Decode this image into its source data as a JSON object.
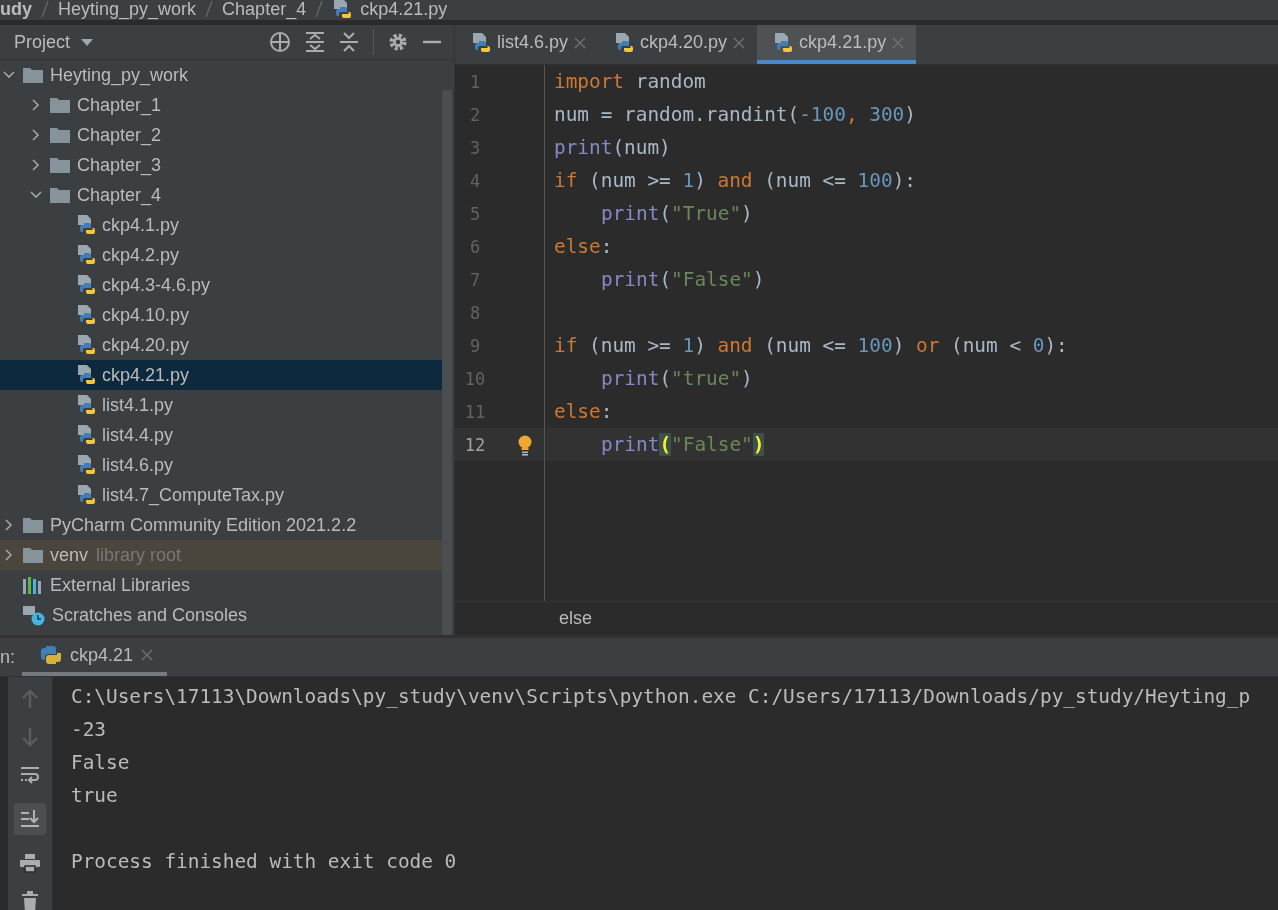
{
  "breadcrumb": [
    {
      "label": "udy",
      "kind": "project"
    },
    {
      "label": "Heyting_py_work",
      "kind": "folder"
    },
    {
      "label": "Chapter_4",
      "kind": "folder"
    },
    {
      "label": "ckp4.21.py",
      "kind": "python"
    }
  ],
  "project_panel": {
    "title": "Project",
    "tree": [
      {
        "label": "Heyting_py_work",
        "kind": "folder",
        "expanded": true,
        "selected": false,
        "children": [
          {
            "label": "Chapter_1",
            "kind": "folder",
            "expanded": false,
            "selected": false
          },
          {
            "label": "Chapter_2",
            "kind": "folder",
            "expanded": false,
            "selected": false
          },
          {
            "label": "Chapter_3",
            "kind": "folder",
            "expanded": false,
            "selected": false
          },
          {
            "label": "Chapter_4",
            "kind": "folder",
            "expanded": true,
            "selected": false,
            "children": [
              {
                "label": "ckp4.1.py",
                "kind": "python",
                "selected": false
              },
              {
                "label": "ckp4.2.py",
                "kind": "python",
                "selected": false
              },
              {
                "label": "ckp4.3-4.6.py",
                "kind": "python",
                "selected": false
              },
              {
                "label": "ckp4.10.py",
                "kind": "python",
                "selected": false
              },
              {
                "label": "ckp4.20.py",
                "kind": "python",
                "selected": false
              },
              {
                "label": "ckp4.21.py",
                "kind": "python",
                "selected": true
              },
              {
                "label": "list4.1.py",
                "kind": "python",
                "selected": false
              },
              {
                "label": "list4.4.py",
                "kind": "python",
                "selected": false
              },
              {
                "label": "list4.6.py",
                "kind": "python",
                "selected": false
              },
              {
                "label": "list4.7_ComputeTax.py",
                "kind": "python",
                "selected": false
              }
            ]
          }
        ]
      },
      {
        "label": "PyCharm Community Edition 2021.2.2",
        "kind": "folder",
        "expanded": false,
        "selected": false
      },
      {
        "label": "venv",
        "hint": "library root",
        "kind": "library-folder",
        "expanded": false,
        "selected": false
      },
      {
        "label": "External Libraries",
        "kind": "libraries",
        "selected": false
      },
      {
        "label": "Scratches and Consoles",
        "kind": "scratches",
        "selected": false
      }
    ]
  },
  "editor_tabs": [
    {
      "label": "list4.6.py",
      "selected": false
    },
    {
      "label": "ckp4.20.py",
      "selected": false
    },
    {
      "label": "ckp4.21.py",
      "selected": true
    }
  ],
  "code_lines": [
    {
      "number": "1",
      "current": false,
      "indent": false,
      "tokens": [
        {
          "t": "import",
          "color": "#cc7832"
        },
        {
          "t": " random",
          "color": "#a9b7c6"
        }
      ]
    },
    {
      "number": "2",
      "current": false,
      "indent": false,
      "tokens": [
        {
          "t": "num = random.randint(",
          "color": "#a9b7c6"
        },
        {
          "t": "-100",
          "color": "#6897bb"
        },
        {
          "t": ", ",
          "color": "#cc7832"
        },
        {
          "t": "300",
          "color": "#6897bb"
        },
        {
          "t": ")",
          "color": "#a9b7c6"
        }
      ]
    },
    {
      "number": "3",
      "current": false,
      "indent": false,
      "tokens": [
        {
          "t": "print",
          "color": "#8888c6"
        },
        {
          "t": "(num)",
          "color": "#a9b7c6"
        }
      ]
    },
    {
      "number": "4",
      "current": false,
      "indent": false,
      "tokens": [
        {
          "t": "if",
          "color": "#cc7832"
        },
        {
          "t": " (num >= ",
          "color": "#a9b7c6"
        },
        {
          "t": "1",
          "color": "#6897bb"
        },
        {
          "t": ") ",
          "color": "#a9b7c6"
        },
        {
          "t": "and",
          "color": "#cc7832"
        },
        {
          "t": " (num <= ",
          "color": "#a9b7c6"
        },
        {
          "t": "100",
          "color": "#6897bb"
        },
        {
          "t": "):",
          "color": "#a9b7c6"
        }
      ]
    },
    {
      "number": "5",
      "current": false,
      "indent": true,
      "tokens": [
        {
          "t": "print",
          "color": "#8888c6"
        },
        {
          "t": "(",
          "color": "#a9b7c6"
        },
        {
          "t": "\"True\"",
          "color": "#6a8759"
        },
        {
          "t": ")",
          "color": "#a9b7c6"
        }
      ]
    },
    {
      "number": "6",
      "current": false,
      "indent": false,
      "tokens": [
        {
          "t": "else",
          "color": "#cc7832"
        },
        {
          "t": ":",
          "color": "#a9b7c6"
        }
      ]
    },
    {
      "number": "7",
      "current": false,
      "indent": true,
      "tokens": [
        {
          "t": "print",
          "color": "#8888c6"
        },
        {
          "t": "(",
          "color": "#a9b7c6"
        },
        {
          "t": "\"False\"",
          "color": "#6a8759"
        },
        {
          "t": ")",
          "color": "#a9b7c6"
        }
      ]
    },
    {
      "number": "8",
      "current": false
    },
    {
      "number": "9",
      "current": false,
      "indent": false,
      "tokens": [
        {
          "t": "if",
          "color": "#cc7832"
        },
        {
          "t": " (num >= ",
          "color": "#a9b7c6"
        },
        {
          "t": "1",
          "color": "#6897bb"
        },
        {
          "t": ") ",
          "color": "#a9b7c6"
        },
        {
          "t": "and",
          "color": "#cc7832"
        },
        {
          "t": " (num <= ",
          "color": "#a9b7c6"
        },
        {
          "t": "100",
          "color": "#6897bb"
        },
        {
          "t": ") ",
          "color": "#a9b7c6"
        },
        {
          "t": "or",
          "color": "#cc7832"
        },
        {
          "t": " (num < ",
          "color": "#a9b7c6"
        },
        {
          "t": "0",
          "color": "#6897bb"
        },
        {
          "t": "):",
          "color": "#a9b7c6"
        }
      ]
    },
    {
      "number": "10",
      "current": false,
      "indent": true,
      "tokens": [
        {
          "t": "print",
          "color": "#8888c6"
        },
        {
          "t": "(",
          "color": "#a9b7c6"
        },
        {
          "t": "\"true\"",
          "color": "#6a8759"
        },
        {
          "t": ")",
          "color": "#a9b7c6"
        }
      ]
    },
    {
      "number": "11",
      "current": false,
      "indent": false,
      "tokens": [
        {
          "t": "else",
          "color": "#cc7832"
        },
        {
          "t": ":",
          "color": "#a9b7c6"
        }
      ]
    },
    {
      "number": "12",
      "indent": true,
      "current": true,
      "bulb": true,
      "tokens": [
        {
          "t": "print",
          "color": "#8888c6"
        },
        {
          "t": "(",
          "matched": true
        },
        {
          "t": "\"False\"",
          "color": "#6a8759"
        },
        {
          "t": ")",
          "matched": true
        }
      ]
    }
  ],
  "editor_breadcrumb": "else",
  "run_panel": {
    "label": "n:",
    "tabs": [
      {
        "label": "ckp4.21",
        "selected": true
      }
    ],
    "console_lines": [
      {
        "kind": "output",
        "text": "C:\\Users\\17113\\Downloads\\py_study\\venv\\Scripts\\python.exe C:/Users/17113/Downloads/py_study/Heyting_p"
      },
      {
        "kind": "output",
        "text": "-23"
      },
      {
        "kind": "output",
        "text": "False"
      },
      {
        "kind": "output",
        "text": "true"
      },
      {
        "kind": "blank"
      },
      {
        "kind": "output",
        "text": "Process finished with exit code 0"
      }
    ]
  }
}
